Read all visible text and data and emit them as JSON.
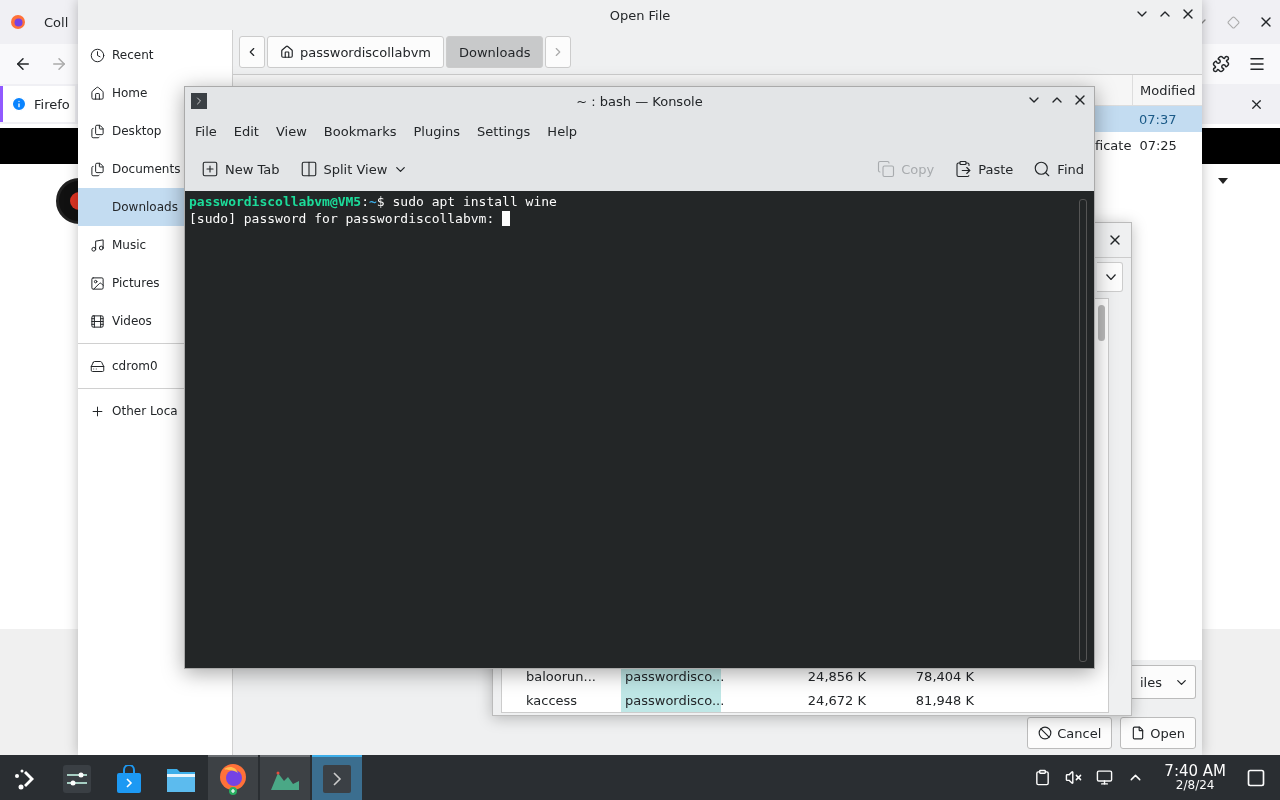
{
  "browser": {
    "tab_title": "Coll",
    "notification": "Firefo"
  },
  "file_dialog": {
    "title": "Open File",
    "places": [
      {
        "label": "Recent",
        "kind": "recent",
        "selected": false
      },
      {
        "label": "Home",
        "kind": "home",
        "selected": false
      },
      {
        "label": "Desktop",
        "kind": "doc",
        "selected": false
      },
      {
        "label": "Documents",
        "kind": "doc",
        "selected": false
      },
      {
        "label": "Downloads",
        "kind": "none",
        "selected": true
      },
      {
        "label": "Music",
        "kind": "music",
        "selected": false
      },
      {
        "label": "Pictures",
        "kind": "picture",
        "selected": false
      },
      {
        "label": "Videos",
        "kind": "video",
        "selected": false
      },
      {
        "label": "cdrom0",
        "kind": "drive",
        "selected": false
      },
      {
        "label": "Other Loca",
        "kind": "plus",
        "selected": false
      }
    ],
    "breadcrumb": [
      {
        "label": "passwordiscollabvm",
        "selected": false
      },
      {
        "label": "Downloads",
        "selected": true
      }
    ],
    "column_header": "Modified",
    "rows": [
      {
        "modified": "07:37",
        "selected": true
      },
      {
        "column_3": "ficate",
        "modified": "07:25",
        "selected": false
      }
    ],
    "filter": "iles",
    "buttons": [
      {
        "label": "Cancel",
        "kind": "cancel"
      },
      {
        "label": "Open",
        "kind": "open"
      }
    ]
  },
  "system_monitor": {
    "rows": [
      {
        "name": "baloorun...",
        "user": "passwordisco...",
        "memory": "24,856 K",
        "shared": "78,404 K"
      },
      {
        "name": "kaccess",
        "user": "passwordisco...",
        "memory": "24,672 K",
        "shared": "81,948 K"
      }
    ]
  },
  "konsole": {
    "title": "~ : bash — Konsole",
    "menu": [
      "File",
      "Edit",
      "View",
      "Bookmarks",
      "Plugins",
      "Settings",
      "Help"
    ],
    "toolbar": [
      {
        "label": "New Tab",
        "kind": "new-tab",
        "disabled": false
      },
      {
        "label": "Split View",
        "kind": "split",
        "disabled": false
      },
      {
        "label": "Copy",
        "kind": "copy",
        "disabled": true
      },
      {
        "label": "Paste",
        "kind": "paste",
        "disabled": false
      },
      {
        "label": "Find",
        "kind": "find",
        "disabled": false
      }
    ],
    "lines": [
      {
        "segments": [
          {
            "kind": "user",
            "text": "passwordiscollabvm@VM5"
          },
          {
            "kind": "plain",
            "text": ":"
          },
          {
            "kind": "path",
            "text": "~"
          },
          {
            "kind": "plain",
            "text": "$ sudo apt install wine"
          }
        ],
        "cursor": false
      },
      {
        "segments": [
          {
            "kind": "plain",
            "text": "[sudo] password for passwordiscollabvm: "
          }
        ],
        "cursor": true
      }
    ]
  },
  "taskbar": {
    "apps": [
      {
        "kind": "launcher",
        "running": false,
        "selected": false
      },
      {
        "kind": "settings",
        "running": false,
        "selected": false
      },
      {
        "kind": "store",
        "running": false,
        "selected": false
      },
      {
        "kind": "files",
        "running": false,
        "selected": false
      },
      {
        "kind": "firefox",
        "running": true,
        "selected": false
      },
      {
        "kind": "monitor",
        "running": true,
        "selected": false
      },
      {
        "kind": "terminal",
        "running": true,
        "selected": true
      }
    ],
    "clock": {
      "time": "7:40 AM",
      "date": "2/8/24"
    }
  }
}
